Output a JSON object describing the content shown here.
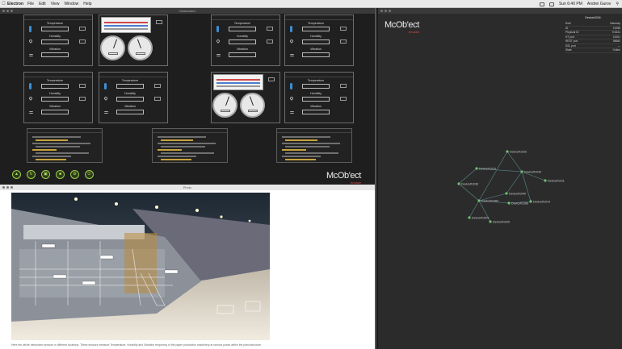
{
  "menubar": {
    "app_name": "Electron",
    "items": [
      "File",
      "Edit",
      "View",
      "Window",
      "Help"
    ],
    "clock": "Sun 6:40 PM",
    "user": "Andrei Gurov"
  },
  "dashboard": {
    "title": "Dashboard",
    "brand_main": "McOb'ect",
    "brand_sub": "envace",
    "labels": {
      "temperature": "Temperature",
      "humidity": "Humidity",
      "vibration": "Vibration"
    }
  },
  "photo_window": {
    "title": "Photo",
    "caption": "Here the whole networked sensors in different locations. These sensors measure Temperature, Humidity and Vibration frequency of the paper production machinery at various points within the plant structure."
  },
  "graph": {
    "brand_main": "McOb'ect",
    "brand_sub": "envace",
    "props": {
      "title": "Device#1004",
      "rows": [
        {
          "key": "Role",
          "value": "Gateway"
        },
        {
          "key": "ID",
          "value": "10055"
        },
        {
          "key": "Physical ID",
          "value": "9-5431"
        },
        {
          "key": "HT port",
          "value": "10001"
        },
        {
          "key": "REST port",
          "value": "58660"
        },
        {
          "key": "SSL port",
          "value": "—"
        },
        {
          "key": "State",
          "value": "Online"
        }
      ]
    },
    "node_labels": [
      "Device#1020",
      "Device#1010",
      "Device#1043",
      "Device#1101",
      "Device#1036",
      "Device#1040",
      "Device#1062",
      "Device#1068",
      "Device#1014",
      "Device#1004",
      "Device#1029"
    ]
  },
  "colors": {
    "accent_green": "#9bcf45",
    "node_green": "#6ec26e",
    "brand_red": "#e34b4b"
  }
}
